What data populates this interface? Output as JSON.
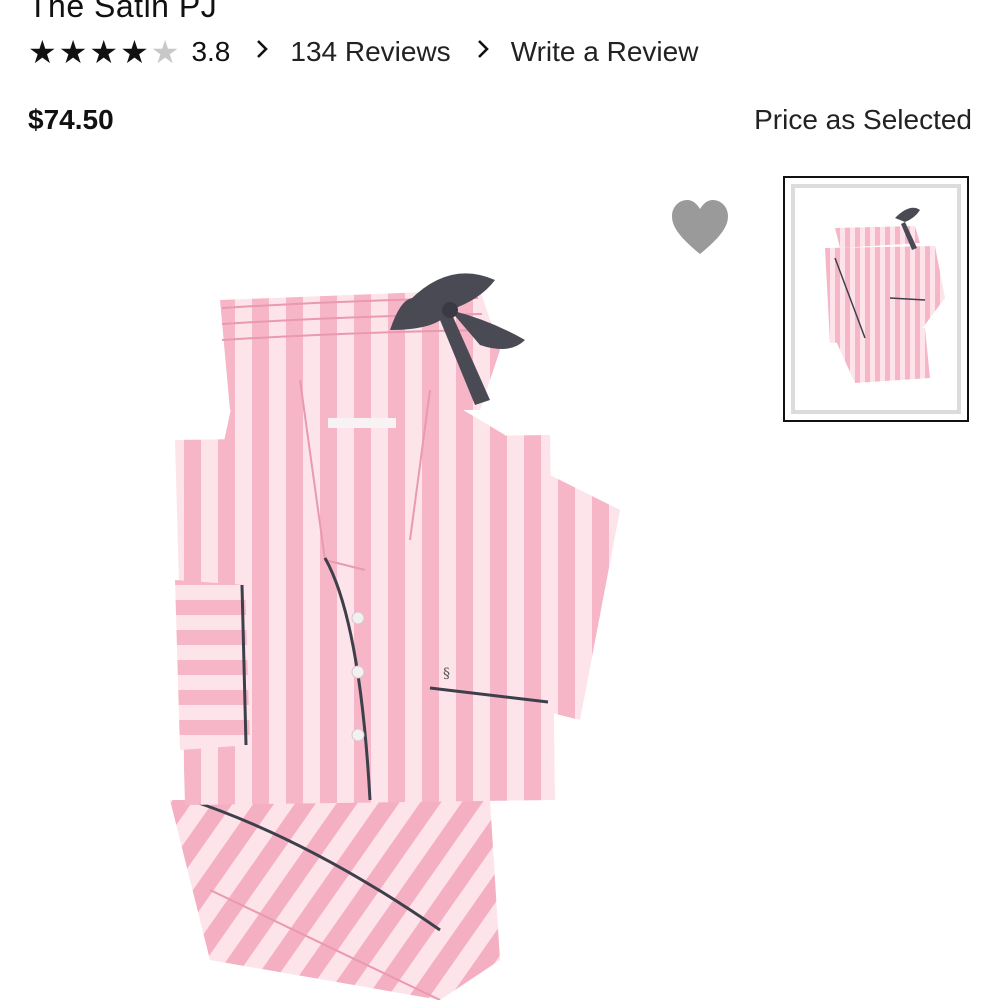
{
  "product": {
    "title": "The Satin PJ",
    "rating": 3.8,
    "rating_display": "3.8",
    "stars_total": 5,
    "stars_filled": 4,
    "reviews_label": "134 Reviews",
    "write_review_label": "Write a Review",
    "price": "$74.50",
    "price_note": "Price as Selected"
  },
  "icons": {
    "chevron": "chevron-right-icon",
    "favorite": "heart-icon"
  },
  "colors": {
    "pink": "#f6b8c8",
    "pink_light": "#fde3ea",
    "ribbon": "#4a4a55",
    "piping": "#3d3f4a",
    "heart": "#9a9a9a"
  }
}
